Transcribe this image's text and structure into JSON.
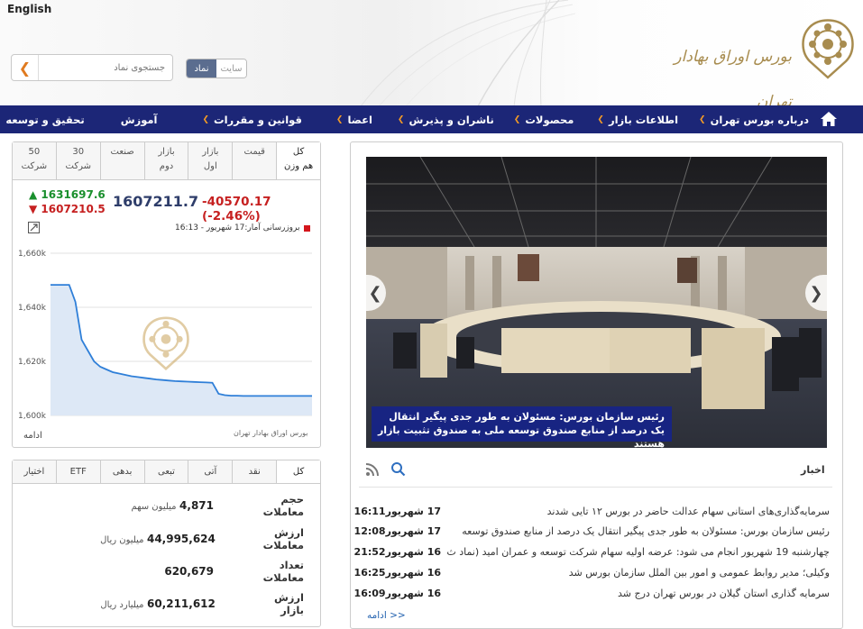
{
  "header": {
    "english_link": "English",
    "logo_text": "بورس اوراق بهادار تهران",
    "search_placeholder": "جستجوی نماد",
    "toggle_site": "سایت",
    "toggle_symbol": "نماد"
  },
  "nav": {
    "items": [
      {
        "label": "درباره بورس تهران",
        "has_menu": true
      },
      {
        "label": "اطلاعات بازار",
        "has_menu": true
      },
      {
        "label": "محصولات",
        "has_menu": true
      },
      {
        "label": "ناشران و پذیرش",
        "has_menu": true
      },
      {
        "label": "اعضا",
        "has_menu": true
      },
      {
        "label": "قوانین و مقررات",
        "has_menu": true
      },
      {
        "label": "آموزش",
        "has_menu": false
      },
      {
        "label": "تحقیق و توسعه",
        "has_menu": false
      }
    ]
  },
  "index_panel": {
    "tabs": [
      {
        "line1": "کل",
        "line2": "هم وزن"
      },
      {
        "line1": "قیمت",
        "line2": ""
      },
      {
        "line1": "بازار",
        "line2": "اول"
      },
      {
        "line1": "بازار",
        "line2": "دوم"
      },
      {
        "line1": "صنعت",
        "line2": ""
      },
      {
        "line1": "30",
        "line2": "شرکت"
      },
      {
        "line1": "50",
        "line2": "شرکت"
      }
    ],
    "high": "1631697.6",
    "low": "1607210.5",
    "value": "1607211.7",
    "change": "-40570.17 (-2.46%)",
    "update_label": "بروزرسانی آمار:17 شهریور - 16:13",
    "source": "بورس اوراق بهادار تهران",
    "more": "ادامه",
    "colors": {
      "up": "#1a8f2d",
      "down": "#c62020",
      "line": "#2f7fd8"
    }
  },
  "chart_data": {
    "type": "area",
    "title": "",
    "xlabel": "",
    "ylabel": "",
    "ylim": [
      1600000,
      1660000
    ],
    "yticks": [
      "1,600k",
      "1,620k",
      "1,640k",
      "1,660k"
    ],
    "yticks_values": [
      1600000,
      1620000,
      1640000,
      1660000
    ],
    "values": [
      1648300,
      1648300,
      1648300,
      1648300,
      1642000,
      1628000,
      1624000,
      1620000,
      1618000,
      1617000,
      1616000,
      1615500,
      1615000,
      1614500,
      1614200,
      1613900,
      1613600,
      1613300,
      1613100,
      1612900,
      1612700,
      1612600,
      1612500,
      1612400,
      1612300,
      1612200,
      1612100,
      1608000,
      1607500,
      1607300,
      1607300,
      1607200,
      1607200,
      1607200,
      1607200,
      1607200,
      1607200,
      1607200,
      1607200,
      1607200,
      1607200,
      1607200,
      1607200
    ],
    "grid": true
  },
  "market_panel": {
    "tabs": [
      "کل",
      "نقد",
      "آتی",
      "تبعی",
      "بدهی",
      "ETF",
      "اختیار"
    ],
    "rows": [
      {
        "label": "حجم معاملات",
        "value": "4,871",
        "unit": "میلیون سهم"
      },
      {
        "label": "ارزش معاملات",
        "value": "44,995,624",
        "unit": "میلیون ریال"
      },
      {
        "label": "تعداد معاملات",
        "value": "620,679",
        "unit": ""
      },
      {
        "label": "ارزش بازار",
        "value": "60,211,612",
        "unit": "میلیارد ریال"
      }
    ]
  },
  "news_panel": {
    "caption": "رئیس سازمان بورس: مسئولان به طور جدی پیگیر انتقال یک درصد از منابع صندوق توسعه ملی به صندوق تثبیت بازار هستند",
    "heading": "اخبار",
    "items": [
      {
        "date": "17 شهریور",
        "time": "16:11",
        "title": "سرمایه‌گذاری‌های استانی سهام عدالت حاضر در بورس ۱۲ تایی شدند"
      },
      {
        "date": "17 شهریور",
        "time": "12:08",
        "title": "رئیس سازمان بورس: مسئولان به طور جدی پیگیر انتقال یک درصد از منابع صندوق توسعه"
      },
      {
        "date": "16 شهریور",
        "time": "21:52",
        "title": "چهارشنبه 19 شهریور انجام می شود: عرضه اولیه سهام شرکت توسعه و عمران امید (نماد ث"
      },
      {
        "date": "16 شهریور",
        "time": "16:25",
        "title": "وکیلی؛ مدیر روابط عمومی و امور بین الملل سازمان بورس شد"
      },
      {
        "date": "16 شهریور",
        "time": "16:09",
        "title": "سرمایه گذاری استان گیلان در بورس تهران درج شد"
      }
    ],
    "more": "ادامه >>"
  }
}
